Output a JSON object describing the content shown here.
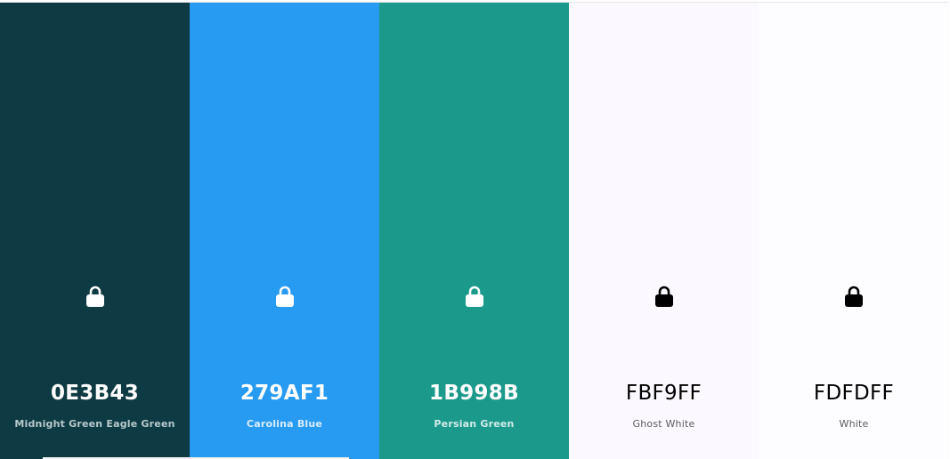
{
  "palette": {
    "swatches": [
      {
        "hex": "0E3B43",
        "name": "Midnight Green Eagle Green",
        "color": "#0E3B43",
        "text_color": "#FFFFFF",
        "name_color": "#B8C8CB",
        "lock_color": "#FFFFFF",
        "lock_icon": "lock-icon"
      },
      {
        "hex": "279AF1",
        "name": "Carolina Blue",
        "color": "#279AF1",
        "text_color": "#FFFFFF",
        "name_color": "#D9ECFC",
        "lock_color": "#FFFFFF",
        "lock_icon": "lock-icon"
      },
      {
        "hex": "1B998B",
        "name": "Persian Green",
        "color": "#1B998B",
        "text_color": "#FFFFFF",
        "name_color": "#D2ECE9",
        "lock_color": "#FFFFFF",
        "lock_icon": "lock-icon"
      },
      {
        "hex": "FBF9FF",
        "name": "Ghost White",
        "color": "#FBF9FF",
        "text_color": "#000000",
        "name_color": "#5A5A60",
        "lock_color": "#000000",
        "lock_icon": "lock-icon"
      },
      {
        "hex": "FDFDFF",
        "name": "White",
        "color": "#FDFDFF",
        "text_color": "#000000",
        "name_color": "#5A5A60",
        "lock_color": "#000000",
        "lock_icon": "lock-icon"
      }
    ]
  }
}
